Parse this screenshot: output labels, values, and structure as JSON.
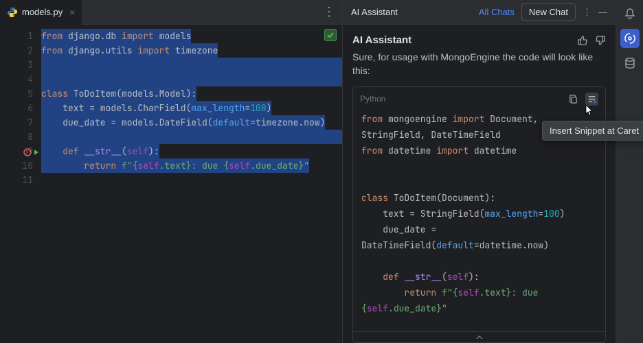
{
  "editor": {
    "tab": {
      "filename": "models.py"
    },
    "lines": [
      "1",
      "2",
      "3",
      "4",
      "5",
      "6",
      "7",
      "8",
      "9",
      "10",
      "11"
    ]
  },
  "editor_code": {
    "l1_kw1": "from",
    "l1_mod": " django.db ",
    "l1_kw2": "import",
    "l1_name": " models",
    "l2_kw1": "from",
    "l2_mod": " django.utils ",
    "l2_kw2": "import",
    "l2_name": " timezone",
    "l5_kw": "class",
    "l5_name": " ToDoItem(models.Model):",
    "l6_a": "    text = models.CharField(",
    "l6_p": "max_length",
    "l6_b": "=",
    "l6_n": "100",
    "l6_c": ")",
    "l7_a": "    due_date = models.DateField(",
    "l7_p": "default",
    "l7_b": "=timezone.now)",
    "l9_a": "    ",
    "l9_kw": "def ",
    "l9_fn": "__str__",
    "l9_b": "(",
    "l9_self": "self",
    "l9_c": "):",
    "l10_a": "        ",
    "l10_kw": "return ",
    "l10_s1": "f\"{",
    "l10_self1": "self",
    "l10_s2": ".text",
    "l10_s3": "}: due {",
    "l10_self2": "self",
    "l10_s4": ".due_date",
    "l10_s5": "}\""
  },
  "assistant": {
    "title": "AI Assistant",
    "all_chats": "All Chats",
    "new_chat": "New Chat",
    "msg_title": "AI Assistant",
    "msg_body": "Sure, for usage with MongoEngine the code will look like this:",
    "code_lang": "Python",
    "tooltip": "Insert Snippet at Caret"
  },
  "snippet": {
    "l1_kw1": "from",
    "l1_m": " mongoengine ",
    "l1_kw2": "import",
    "l1_r": " Document, StringField, DateTimeField",
    "l2_kw1": "from",
    "l2_m": " datetime ",
    "l2_kw2": "import",
    "l2_r": " datetime",
    "l4_kw": "class",
    "l4_r": " ToDoItem(Document):",
    "l5_a": "    text = StringField(",
    "l5_p": "max_length",
    "l5_e": "=",
    "l5_n": "100",
    "l5_c": ")",
    "l6_a": "    due_date = DateTimeField(",
    "l6_p": "default",
    "l6_b": "=datetime.now)",
    "l8_a": "    ",
    "l8_kw": "def ",
    "l8_fn": "__str__",
    "l8_b": "(",
    "l8_self": "self",
    "l8_c": "):",
    "l9_a": "        ",
    "l9_kw": "return ",
    "l9_s1": "f\"{",
    "l9_self1": "self",
    "l9_s2": ".text",
    "l9_s3": "}: due {",
    "l9_self2": "self",
    "l9_s4": ".due_date",
    "l9_s5": "}\""
  }
}
